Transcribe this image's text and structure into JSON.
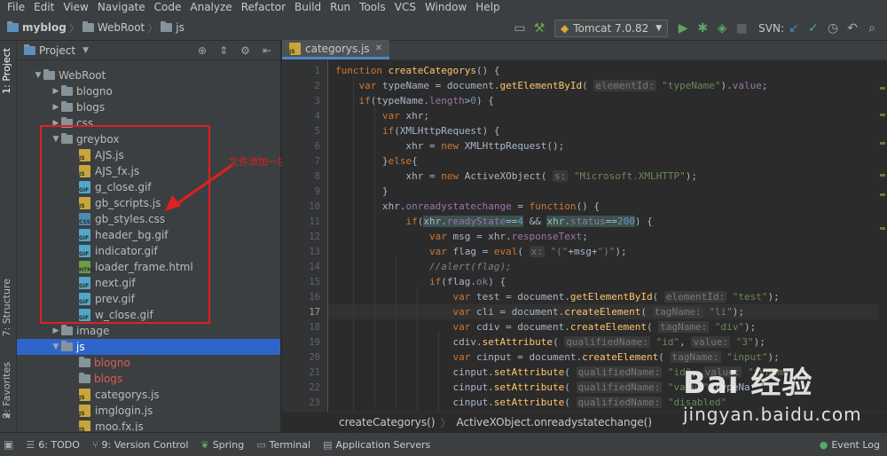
{
  "menu": [
    "File",
    "Edit",
    "View",
    "Navigate",
    "Code",
    "Analyze",
    "Refactor",
    "Build",
    "Run",
    "Tools",
    "VCS",
    "Window",
    "Help"
  ],
  "breadcrumb": [
    "myblog",
    "WebRoot",
    "js"
  ],
  "toolbar": {
    "run_config": "Tomcat 7.0.82",
    "svn_label": "SVN:"
  },
  "left_strip": {
    "project": "1: Project",
    "structure": "7: Structure",
    "favorites": "2: Favorites"
  },
  "project_panel": {
    "title": "Project",
    "tree": [
      {
        "label": "WebRoot",
        "type": "folder",
        "depth": 1,
        "arrow": "▼"
      },
      {
        "label": "blogno",
        "type": "folder",
        "depth": 2,
        "arrow": "▶"
      },
      {
        "label": "blogs",
        "type": "folder",
        "depth": 2,
        "arrow": "▶"
      },
      {
        "label": "css",
        "type": "folder",
        "depth": 2,
        "arrow": "▶"
      },
      {
        "label": "greybox",
        "type": "folder",
        "depth": 2,
        "arrow": "▼"
      },
      {
        "label": "AJS.js",
        "type": "js",
        "depth": 3
      },
      {
        "label": "AJS_fx.js",
        "type": "js",
        "depth": 3
      },
      {
        "label": "g_close.gif",
        "type": "gif",
        "depth": 3
      },
      {
        "label": "gb_scripts.js",
        "type": "js",
        "depth": 3
      },
      {
        "label": "gb_styles.css",
        "type": "css",
        "depth": 3
      },
      {
        "label": "header_bg.gif",
        "type": "gif",
        "depth": 3
      },
      {
        "label": "indicator.gif",
        "type": "gif",
        "depth": 3
      },
      {
        "label": "loader_frame.html",
        "type": "html",
        "depth": 3
      },
      {
        "label": "next.gif",
        "type": "gif",
        "depth": 3
      },
      {
        "label": "prev.gif",
        "type": "gif",
        "depth": 3
      },
      {
        "label": "w_close.gif",
        "type": "gif",
        "depth": 3
      },
      {
        "label": "image",
        "type": "folder",
        "depth": 2,
        "arrow": "▶"
      },
      {
        "label": "js",
        "type": "folder",
        "depth": 2,
        "arrow": "▼",
        "selected": true
      },
      {
        "label": "blogno",
        "type": "folder",
        "depth": 3,
        "red": true
      },
      {
        "label": "blogs",
        "type": "folder",
        "depth": 3,
        "red": true
      },
      {
        "label": "categorys.js",
        "type": "js",
        "depth": 3
      },
      {
        "label": "imglogin.js",
        "type": "js",
        "depth": 3
      },
      {
        "label": "moo.fx.js",
        "type": "js",
        "depth": 3
      }
    ]
  },
  "annotation": "文件添加一块",
  "editor": {
    "tab": "categorys.js",
    "line_numbers": [
      "1",
      "2",
      "3",
      "4",
      "5",
      "6",
      "7",
      "8",
      "9",
      "10",
      "11",
      "12",
      "13",
      "14",
      "15",
      "16",
      "17",
      "18",
      "19",
      "20",
      "21",
      "22",
      "23"
    ],
    "code_lines": [
      "<span class=\"kw\">function </span><span class=\"fn\">createCategorys</span>() {",
      "    <span class=\"kw\">var </span>typeName = document.<span class=\"fn\">getElementById</span>( <span class=\"hint\">elementId:</span> <span class=\"str\">\"typeName\"</span>).<span class=\"prop\">value</span>;",
      "    <span class=\"kw\">if</span>(typeName.<span class=\"prop\">length</span>><span class=\"num\">0</span>) {",
      "        <span class=\"kw\">var </span>xhr;",
      "        <span class=\"kw\">if</span>(XMLHttpRequest) {",
      "            xhr = <span class=\"kw\">new </span>XMLHttpRequest();",
      "        }<span class=\"kw\">else</span>{",
      "            xhr = <span class=\"kw\">new </span>ActiveXObject( <span class=\"hint\">s:</span> <span class=\"str\">\"Microsoft.XMLHTTP\"</span>);",
      "        }",
      "        xhr.<span class=\"prop\">onreadystatechange</span> = <span class=\"kw\">function</span>() {",
      "            <span class=\"kw\">if</span>(<span class=\"brk\">xhr.<span class=\"prop\">readyState</span>==<span class=\"num\">4</span></span> && <span class=\"brk\">xhr.<span class=\"prop\">status</span>==<span class=\"num\">200</span></span>) {",
      "                <span class=\"kw\">var </span>msg = xhr.<span class=\"prop\">responseText</span>;",
      "                <span class=\"kw\">var </span>flag = <span class=\"kw\">eval</span>( <span class=\"hint\">x:</span> <span class=\"str\">\"(\"</span>+msg+<span class=\"str\">\")\"</span>);",
      "                <span class=\"com\">//alert(flag);</span>",
      "                <span class=\"kw\">if</span>(flag.<span class=\"prop\">ok</span>) {",
      "                    <span class=\"kw\">var </span>test = document.<span class=\"fn\">getElementById</span>( <span class=\"hint\">elementId:</span> <span class=\"str\">\"test\"</span>);",
      "                    <span class=\"kw\">var </span>cli = document.<span class=\"fn\">createElement</span>( <span class=\"hint\">tagName:</span> <span class=\"str\">\"li\"</span>);",
      "                    <span class=\"kw\">var </span>cdiv = document.<span class=\"fn\">createElement</span>( <span class=\"hint\">tagName:</span> <span class=\"str\">\"div\"</span>);",
      "                    cdiv.<span class=\"fn\">setAttribute</span>( <span class=\"hint\">qualifiedName:</span> <span class=\"str\">\"id\"</span>, <span class=\"hint\">value:</span> <span class=\"str\">\"3\"</span>);",
      "                    <span class=\"kw\">var </span>cinput = document.<span class=\"fn\">createElement</span>( <span class=\"hint\">tagName:</span> <span class=\"str\">\"input\"</span>);",
      "                    cinput.<span class=\"fn\">setAttribute</span>( <span class=\"hint\">qualifiedName:</span> <span class=\"str\">\"id\"</span>, <span class=\"hint\">value:</span> <span class=\"str\">\"tyname\"</span>",
      "                    cinput.<span class=\"fn\">setAttribute</span>( <span class=\"hint\">qualifiedName:</span> <span class=\"str\">\"value\"</span>,typeNa",
      "                    cinput.<span class=\"fn\">setAttribute</span>( <span class=\"hint\">qualifiedName:</span> <span class=\"str\">\"disabled\"</span>"
    ],
    "current_line": 17,
    "breadcrumb": [
      "createCategorys()",
      "ActiveXObject.onreadystatechange()"
    ]
  },
  "status_bar": {
    "items": [
      "6: TODO",
      "9: Version Control",
      "Spring",
      "Terminal",
      "Application Servers"
    ],
    "event_log": "Event Log"
  },
  "watermark": {
    "line1": "Bai 经验",
    "line2": "jingyan.baidu.com"
  }
}
